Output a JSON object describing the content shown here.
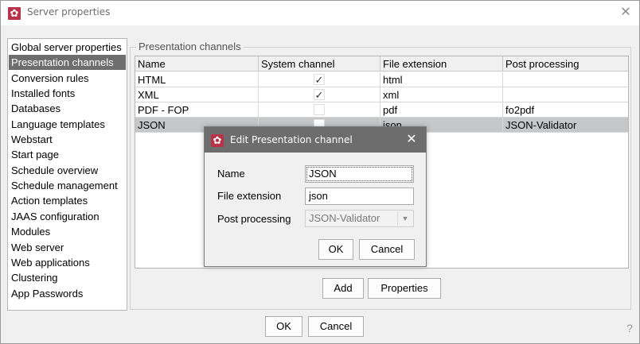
{
  "window": {
    "title": "Server properties",
    "close": "✕"
  },
  "sidebar": {
    "items": [
      {
        "label": "Global server properties",
        "selected": false
      },
      {
        "label": "Presentation channels",
        "selected": true
      },
      {
        "label": "Conversion rules",
        "selected": false
      },
      {
        "label": "Installed fonts",
        "selected": false
      },
      {
        "label": "Databases",
        "selected": false
      },
      {
        "label": "Language templates",
        "selected": false
      },
      {
        "label": "Webstart",
        "selected": false
      },
      {
        "label": "Start page",
        "selected": false
      },
      {
        "label": "Schedule overview",
        "selected": false
      },
      {
        "label": "Schedule management",
        "selected": false
      },
      {
        "label": "Action templates",
        "selected": false
      },
      {
        "label": "JAAS configuration",
        "selected": false
      },
      {
        "label": "Modules",
        "selected": false
      },
      {
        "label": "Web server",
        "selected": false
      },
      {
        "label": "Web applications",
        "selected": false
      },
      {
        "label": "Clustering",
        "selected": false
      },
      {
        "label": "App Passwords",
        "selected": false
      }
    ]
  },
  "panel": {
    "legend": "Presentation channels",
    "table": {
      "headers": [
        "Name",
        "System channel",
        "File extension",
        "Post processing"
      ],
      "rows": [
        {
          "name": "HTML",
          "system": true,
          "ext": "html",
          "post": "",
          "selected": false
        },
        {
          "name": "XML",
          "system": true,
          "ext": "xml",
          "post": "",
          "selected": false
        },
        {
          "name": "PDF - FOP",
          "system": false,
          "ext": "pdf",
          "post": "fo2pdf",
          "selected": false
        },
        {
          "name": "JSON",
          "system": false,
          "ext": "json",
          "post": "JSON-Validator",
          "selected": true
        }
      ]
    },
    "add_label": "Add",
    "properties_label": "Properties"
  },
  "footer": {
    "ok_label": "OK",
    "cancel_label": "Cancel",
    "help": "?"
  },
  "dialog": {
    "title": "Edit Presentation channel",
    "close": "✕",
    "name_label": "Name",
    "name_value": "JSON",
    "ext_label": "File extension",
    "ext_value": "json",
    "post_label": "Post processing",
    "post_value": "JSON-Validator",
    "ok_label": "OK",
    "cancel_label": "Cancel"
  },
  "icons": {
    "app": "gear-icon",
    "check": "✓",
    "dropdown": "▼"
  },
  "colors": {
    "accent": "#b83248",
    "selection": "#6e6e6e",
    "row_selected": "#c5c7c8"
  }
}
